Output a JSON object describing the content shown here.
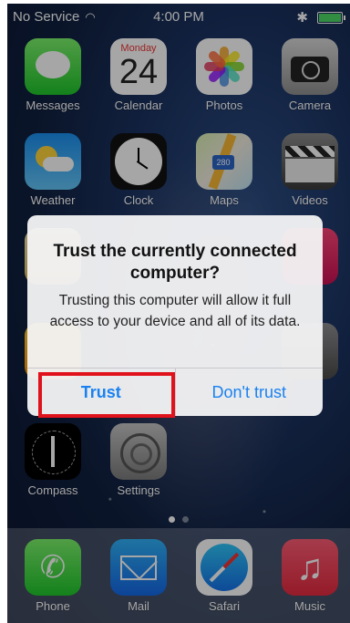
{
  "status_bar": {
    "carrier": "No Service",
    "time": "4:00 PM",
    "bluetooth": "✱"
  },
  "home_apps": [
    {
      "label": "Messages"
    },
    {
      "label": "Calendar",
      "weekday": "Monday",
      "date": "24"
    },
    {
      "label": "Photos"
    },
    {
      "label": "Camera"
    },
    {
      "label": "Weather"
    },
    {
      "label": "Clock"
    },
    {
      "label": "Maps",
      "shield": "280"
    },
    {
      "label": "Videos"
    },
    {
      "label": "Compass"
    },
    {
      "label": "Settings"
    }
  ],
  "dock_apps": [
    {
      "label": "Phone"
    },
    {
      "label": "Mail"
    },
    {
      "label": "Safari"
    },
    {
      "label": "Music"
    }
  ],
  "alert": {
    "title": "Trust the currently connected computer?",
    "message": "Trusting this computer will allow it full access to your device and all of its data.",
    "trust_label": "Trust",
    "dont_trust_label": "Don't trust"
  },
  "colors": {
    "accent": "#1a82f0",
    "highlight": "#e0121b"
  },
  "icons": {
    "phone_glyph": "✆",
    "music_glyph": "♫"
  }
}
